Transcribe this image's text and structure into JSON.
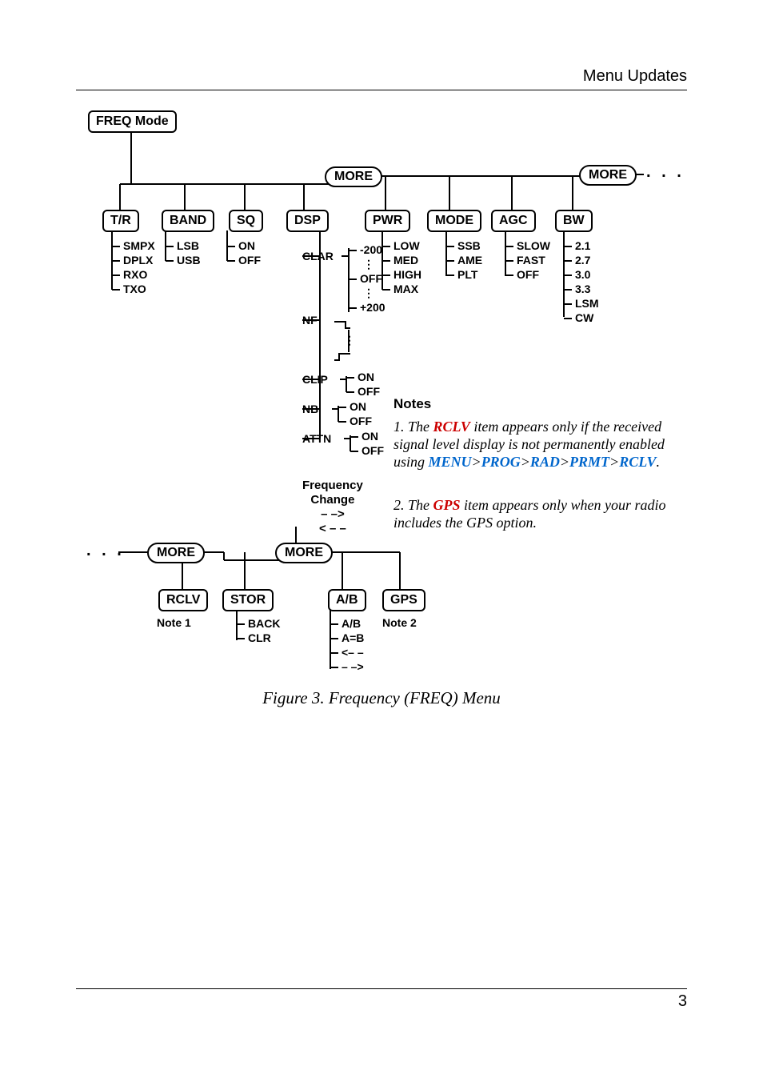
{
  "header": {
    "section": "Menu Updates"
  },
  "caption": "Figure 3. Frequency (FREQ) Menu",
  "page_number": "3",
  "root_box": "FREQ Mode",
  "row1": {
    "TR": {
      "label": "T/R",
      "items": [
        "SMPX",
        "DPLX",
        "RXO",
        "TXO"
      ]
    },
    "BAND": {
      "label": "BAND",
      "items": [
        "LSB",
        "USB"
      ]
    },
    "SQ": {
      "label": "SQ",
      "items": [
        "ON",
        "OFF"
      ]
    },
    "DSP": {
      "label": "DSP",
      "subs": {
        "CLAR": [
          "-200",
          "⋮",
          "OFF",
          "⋮",
          "+200"
        ],
        "NF": [
          "⁠",
          "⋮",
          "⁠"
        ],
        "CLIP": [
          "ON",
          "OFF"
        ],
        "NB": [
          "ON",
          "OFF"
        ],
        "ATTN": [
          "ON",
          "OFF"
        ]
      }
    },
    "MORE1": "MORE",
    "PWR": {
      "label": "PWR",
      "items": [
        "LOW",
        "MED",
        "HIGH",
        "MAX"
      ]
    },
    "MODE": {
      "label": "MODE",
      "items": [
        "SSB",
        "AME",
        "PLT"
      ]
    },
    "AGC": {
      "label": "AGC",
      "items": [
        "SLOW",
        "FAST",
        "OFF"
      ]
    },
    "BW": {
      "label": "BW",
      "items": [
        "2.1",
        "2.7",
        "3.0",
        "3.3",
        "LSM",
        "CW"
      ]
    },
    "MORE2": "MORE"
  },
  "freq_change_header": [
    "Frequency",
    "Change",
    "– –>",
    "< – –"
  ],
  "row2": {
    "MORE_left": "MORE",
    "MORE_right": "MORE",
    "RCLV": {
      "label": "RCLV",
      "note": "Note 1"
    },
    "STOR": {
      "label": "STOR",
      "items": [
        "BACK",
        "CLR"
      ]
    },
    "AB": {
      "label": "A/B",
      "items": [
        "A/B",
        "A=B",
        "<– –",
        "– –>"
      ]
    },
    "GPS": {
      "label": "GPS",
      "note": "Note 2"
    }
  },
  "notes": {
    "title": "Notes",
    "n1_pre": "1. The ",
    "n1_rclv": "RCLV",
    "n1_mid": " item appears only if the received signal level display is not permanently enabled using ",
    "menu_path": {
      "a": "MENU",
      "b": "PROG",
      "c": "RAD",
      "d": "PRMT",
      "e": "RCLV"
    },
    "gt": ">",
    "n2_pre": "2. The ",
    "n2_gps": "GPS",
    "n2_post": " item appears only when your radio includes the GPS option."
  }
}
